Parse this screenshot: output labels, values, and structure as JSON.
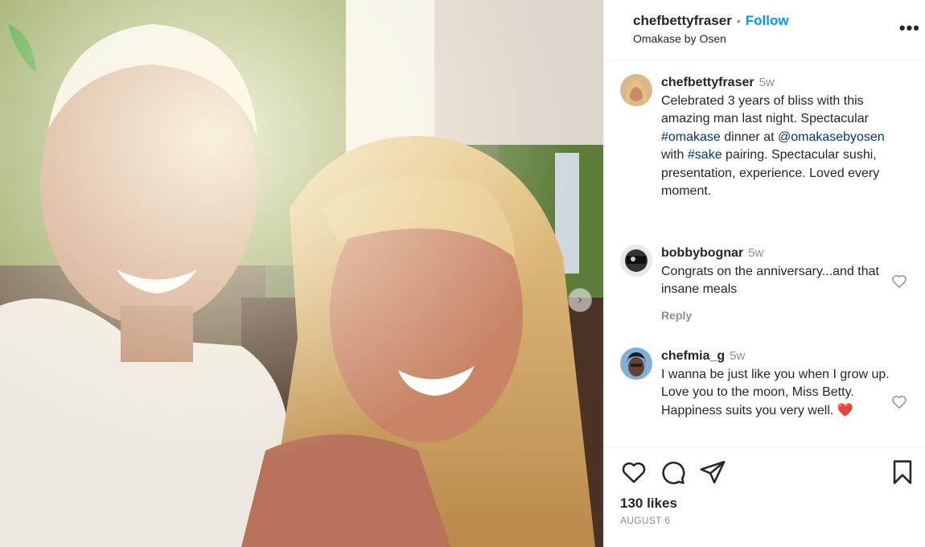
{
  "post": {
    "username": "chefbettyfraser",
    "follow_label": "Follow",
    "location": "Omakase by Osen",
    "more_label": "•••"
  },
  "caption": {
    "username": "chefbettyfraser",
    "ago": "5w",
    "text_part1": "Celebrated 3 years of bliss with this amazing man last night. Spectacular ",
    "hashtag1": "#omakase",
    "text_part2": " dinner at ",
    "mention": "@omakasebyosen",
    "text_part3": " with ",
    "hashtag2": "#sake",
    "text_part4": " pairing. Spectacular sushi, presentation, experience. Loved every moment."
  },
  "comments": [
    {
      "username": "bobbybognar",
      "ago": "5w",
      "text": "Congrats on the anniversary...and that insane meals",
      "reply_label": "Reply"
    },
    {
      "username": "chefmia_g",
      "ago": "5w",
      "text": "I wanna be just like you when I grow up. Love you to the moon, Miss Betty. Happiness suits you very well.",
      "emoji": "❤️"
    }
  ],
  "footer": {
    "likes": "130 likes",
    "date": "AUGUST 6"
  },
  "colors": {
    "accent": "#0095f6",
    "link": "#00376b",
    "muted": "#8e8e8e",
    "heart_emoji": "#e0245e"
  },
  "icons": {
    "more": "more-horizontal-icon",
    "like": "heart-icon",
    "comment": "comment-bubble-icon",
    "share": "paper-plane-icon",
    "save": "bookmark-icon",
    "carousel": "chevron-right-icon"
  }
}
